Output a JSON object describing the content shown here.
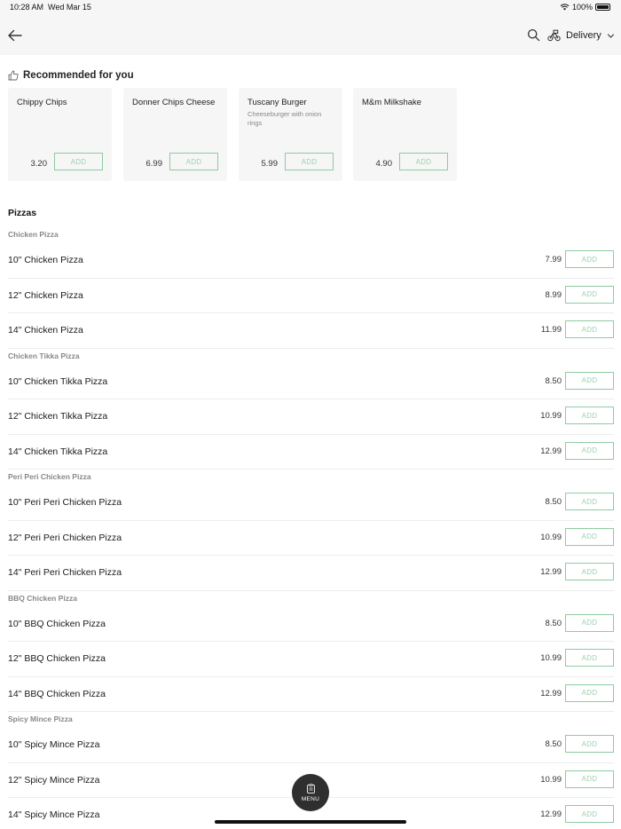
{
  "status_bar": {
    "time": "10:28 AM",
    "date": "Wed Mar 15",
    "battery_text": "100%",
    "battery_level": 1.0
  },
  "nav": {
    "back_icon": "arrow-left-icon",
    "search_icon": "search-icon",
    "mode_icon": "bicycle-delivery-icon",
    "mode_label": "Delivery",
    "chevron_icon": "chevron-down-icon"
  },
  "recommended": {
    "title": "Recommended for you",
    "icon": "thumbs-up-icon",
    "items": [
      {
        "name": "Chippy Chips",
        "desc": "",
        "price": "3.20",
        "add": "ADD"
      },
      {
        "name": "Donner Chips Cheese",
        "desc": "",
        "price": "6.99",
        "add": "ADD"
      },
      {
        "name": "Tuscany Burger",
        "desc": "Cheeseburger with onion rings",
        "price": "5.99",
        "add": "ADD"
      },
      {
        "name": "M&m Milkshake",
        "desc": "",
        "price": "4.90",
        "add": "ADD"
      }
    ]
  },
  "section": {
    "title": "Pizzas",
    "groups": [
      {
        "name": "Chicken Pizza",
        "items": [
          {
            "name": "10\" Chicken Pizza",
            "price": "7.99",
            "add": "ADD"
          },
          {
            "name": "12\" Chicken Pizza",
            "price": "8.99",
            "add": "ADD"
          },
          {
            "name": "14\" Chicken Pizza",
            "price": "11.99",
            "add": "ADD"
          }
        ]
      },
      {
        "name": "Chicken Tikka Pizza",
        "items": [
          {
            "name": "10\" Chicken Tikka Pizza",
            "price": "8.50",
            "add": "ADD"
          },
          {
            "name": "12\" Chicken Tikka Pizza",
            "price": "10.99",
            "add": "ADD"
          },
          {
            "name": "14\" Chicken Tikka Pizza",
            "price": "12.99",
            "add": "ADD"
          }
        ]
      },
      {
        "name": "Peri Peri Chicken Pizza",
        "items": [
          {
            "name": "10\" Peri Peri Chicken Pizza",
            "price": "8.50",
            "add": "ADD"
          },
          {
            "name": "12\" Peri Peri Chicken Pizza",
            "price": "10.99",
            "add": "ADD"
          },
          {
            "name": "14\" Peri Peri Chicken Pizza",
            "price": "12.99",
            "add": "ADD"
          }
        ]
      },
      {
        "name": "BBQ Chicken Pizza",
        "items": [
          {
            "name": "10\" BBQ Chicken Pizza",
            "price": "8.50",
            "add": "ADD"
          },
          {
            "name": "12\" BBQ Chicken Pizza",
            "price": "10.99",
            "add": "ADD"
          },
          {
            "name": "14\" BBQ Chicken Pizza",
            "price": "12.99",
            "add": "ADD"
          }
        ]
      },
      {
        "name": "Spicy Mince Pizza",
        "items": [
          {
            "name": "10\" Spicy Mince Pizza",
            "price": "8.50",
            "add": "ADD"
          },
          {
            "name": "12\" Spicy Mince Pizza",
            "price": "10.99",
            "add": "ADD"
          },
          {
            "name": "14\" Spicy Mince Pizza",
            "price": "12.99",
            "add": "ADD"
          }
        ]
      }
    ]
  },
  "fab": {
    "label": "MENU",
    "icon": "clipboard-menu-icon"
  },
  "colors": {
    "accent_green": "#8ecba0",
    "header_bg": "#f6f6f6",
    "card_bg": "#f6f6f6",
    "fab_bg": "#2f2f2f"
  }
}
